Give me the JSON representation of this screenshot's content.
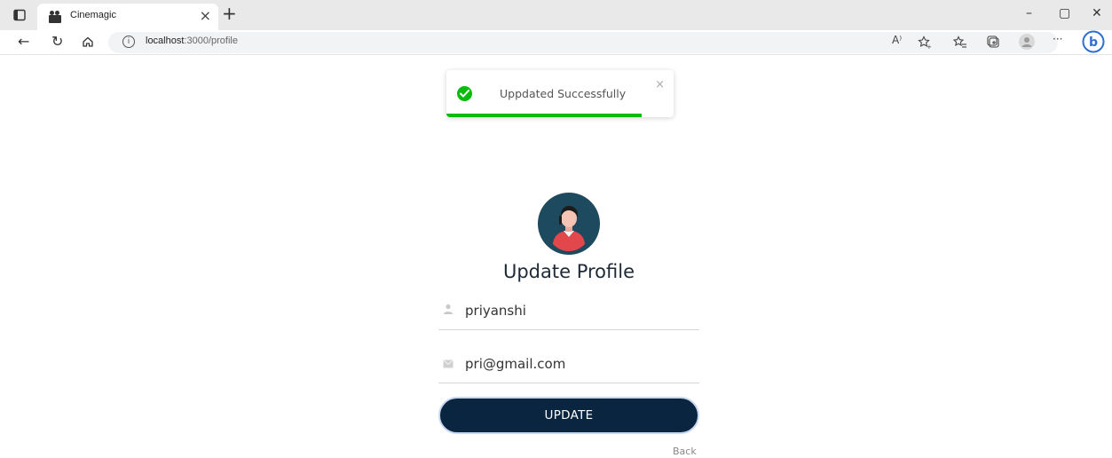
{
  "browser": {
    "tab_title": "Cinemagic",
    "tab_close": "×",
    "new_tab": "+",
    "address_host": "localhost",
    "address_path": ":3000/profile",
    "read_aloud": "A⁾",
    "more_menu": "···",
    "win_minimize": "–",
    "win_restore": "▢",
    "win_close": "✕"
  },
  "toast": {
    "message": "Uppdated Successfully",
    "close": "×",
    "progress_fraction": 0.86,
    "color": "#07bc0c"
  },
  "form": {
    "title": "Update Profile",
    "name_value": "priyanshi",
    "email_value": "pri@gmail.com",
    "submit_label": "UPDATE",
    "back_label": "Back",
    "button_color": "#0a2540"
  },
  "icons": {
    "user_field": "user-icon",
    "email_field": "envelope-icon",
    "toast_status": "check-circle-icon"
  }
}
